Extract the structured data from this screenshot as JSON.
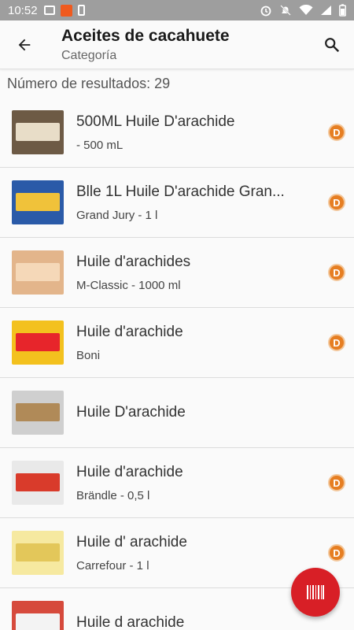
{
  "status_bar": {
    "time": "10:52"
  },
  "app_bar": {
    "title": "Aceites de cacahuete",
    "subtitle": "Categoría"
  },
  "result_count": "Número de resultados: 29",
  "items": [
    {
      "name": "500ML Huile D'arachide",
      "brand": " - 500 mL",
      "grade": "D",
      "thumb_colors": [
        "#6d5a45",
        "#e8ddc8"
      ]
    },
    {
      "name": "Blle 1L Huile D'arachide Gran...",
      "brand": "Grand Jury - 1 l",
      "grade": "D",
      "thumb_colors": [
        "#2a5aa8",
        "#f0c23a"
      ]
    },
    {
      "name": "Huile d'arachides",
      "brand": "M-Classic - 1000 ml",
      "grade": "D",
      "thumb_colors": [
        "#e3b58b",
        "#f5d8b8"
      ]
    },
    {
      "name": "Huile d'arachide",
      "brand": "Boni",
      "grade": "D",
      "thumb_colors": [
        "#f3c11e",
        "#e7252b"
      ]
    },
    {
      "name": "Huile D'arachide",
      "brand": "",
      "grade": "",
      "thumb_colors": [
        "#cfcfcf",
        "#b08a58"
      ]
    },
    {
      "name": "Huile d'arachide",
      "brand": "Brändle - 0,5 l",
      "grade": "D",
      "thumb_colors": [
        "#e9e9e9",
        "#d93b2b"
      ]
    },
    {
      "name": "Huile d' arachide",
      "brand": "Carrefour - 1 l",
      "grade": "D",
      "thumb_colors": [
        "#f6e9a0",
        "#e3c75a"
      ]
    },
    {
      "name": "Huile d arachide",
      "brand": "",
      "grade": "",
      "thumb_colors": [
        "#d64a3c",
        "#f3f3f3"
      ]
    }
  ],
  "colors": {
    "accent": "#d81f26",
    "grade_d": "#e67e22"
  },
  "icons": {
    "back": "arrow-back-icon",
    "search": "search-icon",
    "fab": "barcode-icon"
  }
}
